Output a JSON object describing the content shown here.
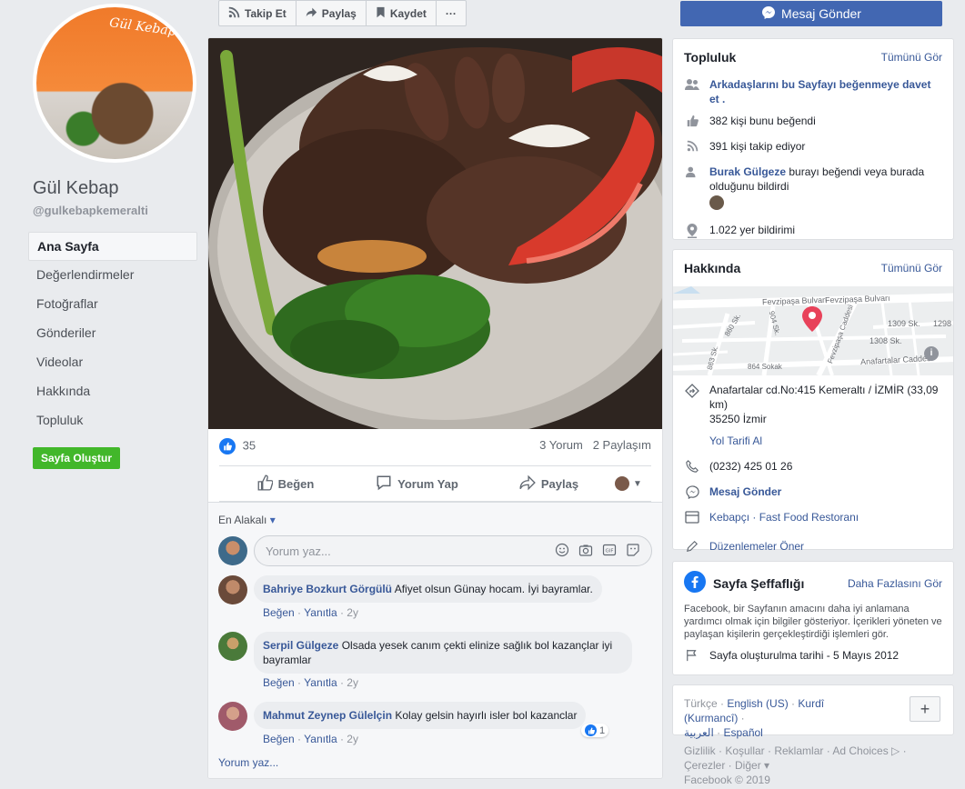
{
  "page": {
    "name": "Gül Kebap",
    "handle": "@gulkebapkemeralti",
    "avatar_text": "Gül Kebap",
    "create_page_label": "Sayfa Oluştur"
  },
  "nav": [
    "Ana Sayfa",
    "Değerlendirmeler",
    "Fotoğraflar",
    "Gönderiler",
    "Videolar",
    "Hakkında",
    "Topluluk"
  ],
  "toolbar": {
    "follow": "Takip Et",
    "share": "Paylaş",
    "save": "Kaydet",
    "more": "···",
    "message": "Mesaj Gönder"
  },
  "post": {
    "like_count": "35",
    "comment_count": "3 Yorum",
    "share_count": "2 Paylaşım",
    "like_label": "Beğen",
    "comment_label": "Yorum Yap",
    "share_label": "Paylaş",
    "sort_label": "En Alakalı",
    "comment_placeholder": "Yorum yaz...",
    "more_comments": "Yorum yaz...",
    "comments": [
      {
        "name": "Bahriye Bozkurt Görgülü",
        "text": "Afiyet olsun Günay hocam. İyi bayramlar.",
        "like": "Beğen",
        "reply": "Yanıtla",
        "time": "2y"
      },
      {
        "name": "Serpil Gülgeze",
        "text": "Olsada yesek canım çekti elinize sağlık bol kazançlar iyi bayramlar",
        "like": "Beğen",
        "reply": "Yanıtla",
        "time": "2y"
      },
      {
        "name": "Mahmut Zeynep Gülelçin",
        "text": "Kolay gelsin hayırlı isler bol kazanclar",
        "like": "Beğen",
        "reply": "Yanıtla",
        "time": "2y",
        "reactions": "1"
      }
    ]
  },
  "community": {
    "title": "Topluluk",
    "see_all": "Tümünü Gör",
    "invite": "Arkadaşlarını bu Sayfayı beğenmeye davet et .",
    "likes": "382 kişi bunu beğendi",
    "follows": "391 kişi takip ediyor",
    "checkin_name": "Burak Gülgeze",
    "checkin_text": " burayı beğendi veya burada olduğunu bildirdi",
    "checkins": "1.022 yer bildirimi"
  },
  "about": {
    "title": "Hakkında",
    "see_all": "Tümünü Gör",
    "map_labels": {
      "street1": "Fevzipaşa Bulvarı",
      "street2": "Fevzipaşa Bulvarı",
      "s860": "860 Sk.",
      "s1309": "1309 Sk.",
      "s1308": "1308 Sk.",
      "s1298": "1298",
      "s864": "864 Sokak",
      "s863": "863 Sk.",
      "s904": "904 Sk.",
      "anafartalar": "Anafartalar Caddesi",
      "fevzipasa_cad": "Fevzipaşa Caddesi"
    },
    "address_line1": "Anafartalar cd.No:415 Kemeraltı / İZMİR (33,09 km)",
    "address_line2": "35250 İzmir",
    "directions": "Yol Tarifi Al",
    "phone": "(0232) 425 01 26",
    "message": "Mesaj Gönder",
    "categories": "Kebapçı · Fast Food Restoranı",
    "suggest_edits": "Düzenlemeler Öner"
  },
  "transparency": {
    "title": "Sayfa Şeffaflığı",
    "more": "Daha Fazlasını Gör",
    "text": "Facebook, bir Sayfanın amacını daha iyi anlamana yardımcı olmak için bilgiler gösteriyor. İçerikleri yöneten ve paylaşan kişilerin gerçekleştirdiği işlemleri gör.",
    "created": "Sayfa oluşturulma tarihi - 5 Mayıs 2012"
  },
  "languages": {
    "current": "Türkçe",
    "sep": " · ",
    "english": "English (US)",
    "kurdish": "Kurdî (Kurmancî)",
    "arabic": "العربية",
    "spanish": "Español",
    "plus": "+"
  },
  "footer": {
    "line1": "Gizlilik · Koşullar · Reklamlar · Ad Choices ▷ ·",
    "line2": "Çerezler · Diğer ▾",
    "line3": "Facebook © 2019"
  },
  "colors": {
    "fb_blue": "#4267b2",
    "link": "#385898",
    "green": "#42b72a",
    "pin": "#e8425a"
  }
}
